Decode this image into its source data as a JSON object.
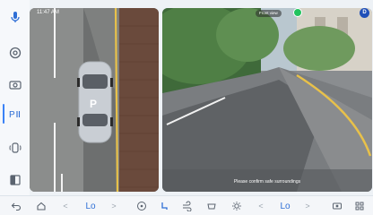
{
  "status_bar": {
    "time": "11:47 AM"
  },
  "parking_view": {
    "car_badge": "P"
  },
  "camera_view": {
    "caption": "Please confirm safe surroundings",
    "left_tag": "Front view",
    "profile_badge": "D"
  },
  "climate": {
    "left_temp": "Lo",
    "right_temp": "Lo",
    "decrease_glyph": "<",
    "increase_glyph": ">"
  },
  "colors": {
    "accent": "#2f6fd6",
    "guide_line": "#e8c14a"
  }
}
